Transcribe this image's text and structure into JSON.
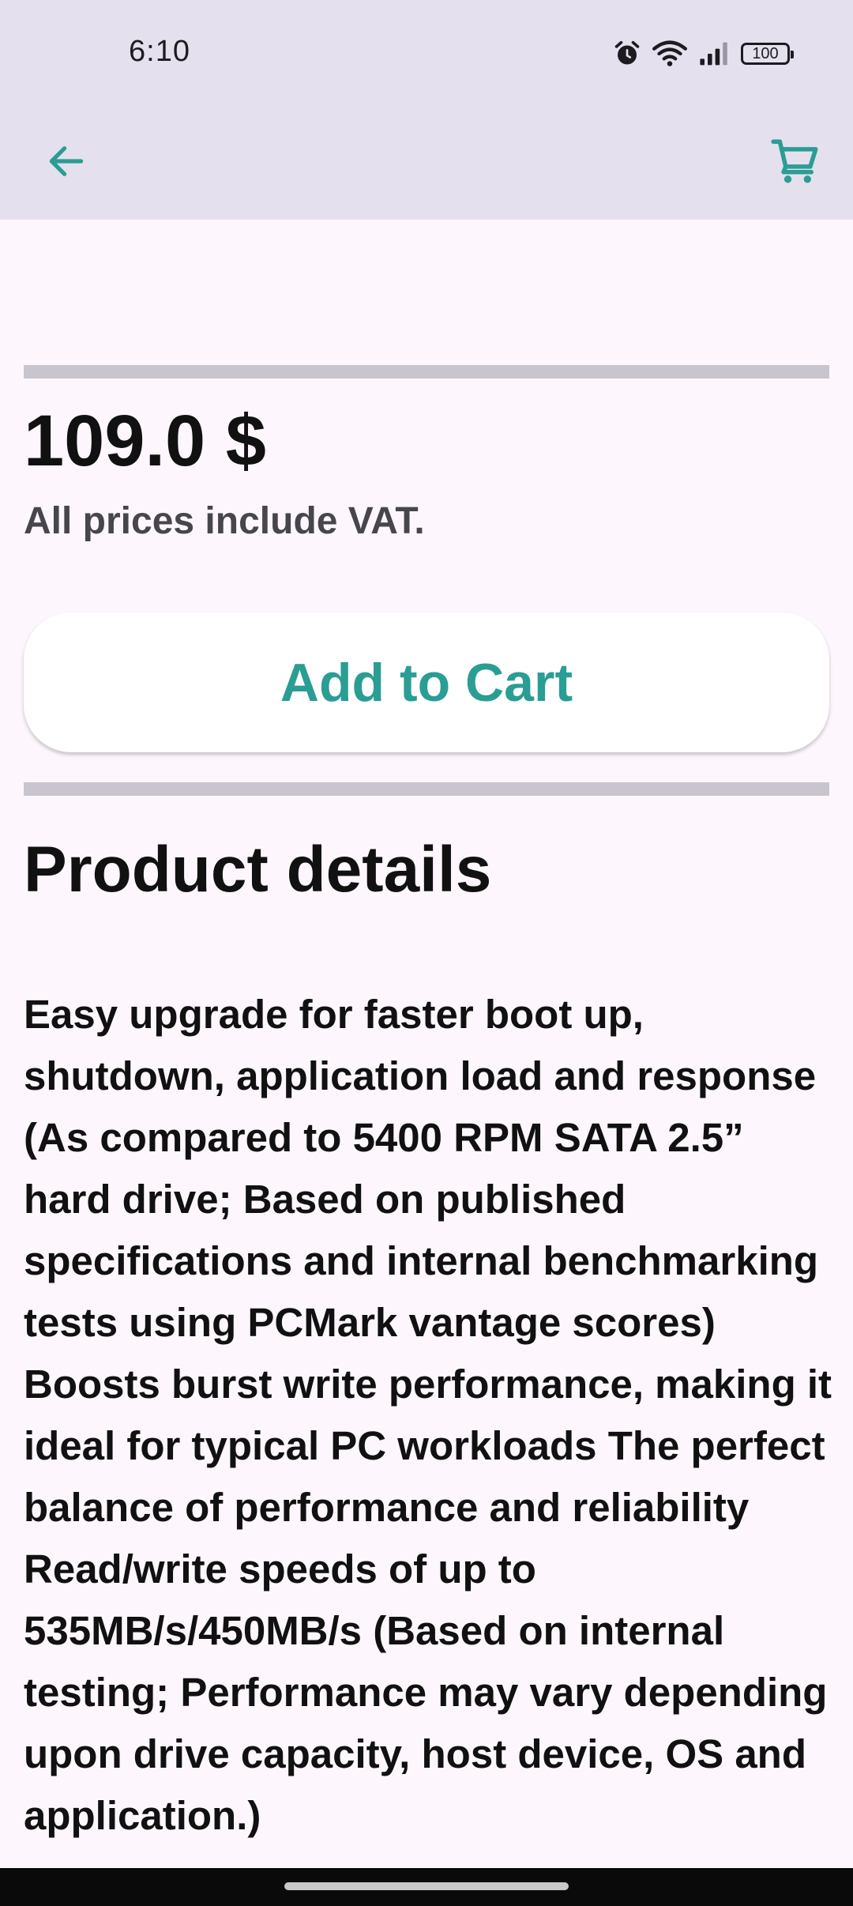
{
  "status_bar": {
    "time": "6:10",
    "battery_level": "100",
    "icons": [
      "alarm-icon",
      "wifi-icon",
      "signal-icon",
      "battery-icon"
    ]
  },
  "app_bar": {
    "back_icon": "arrow-left-icon",
    "cart_icon": "shopping-cart-icon",
    "accent_color": "#2a9d94"
  },
  "product": {
    "price": "109.0 $",
    "vat_note": "All prices include VAT.",
    "add_to_cart_label": "Add to Cart",
    "details_title": "Product details",
    "description": "Easy upgrade for faster boot up, shutdown, application load and response (As compared to 5400 RPM SATA 2.5” hard drive; Based on published specifications and internal benchmarking tests using PCMark vantage scores) Boosts burst write performance, making it ideal for typical PC workloads The perfect balance of performance and reliability Read/write speeds of up to 535MB/s/450MB/s (Based on internal testing; Performance may vary depending upon drive capacity, host device, OS and application.)"
  },
  "colors": {
    "header_background": "#e5e0ee",
    "page_background": "#fdf7fd",
    "divider": "#c9c5cf",
    "accent": "#2a9d94"
  }
}
